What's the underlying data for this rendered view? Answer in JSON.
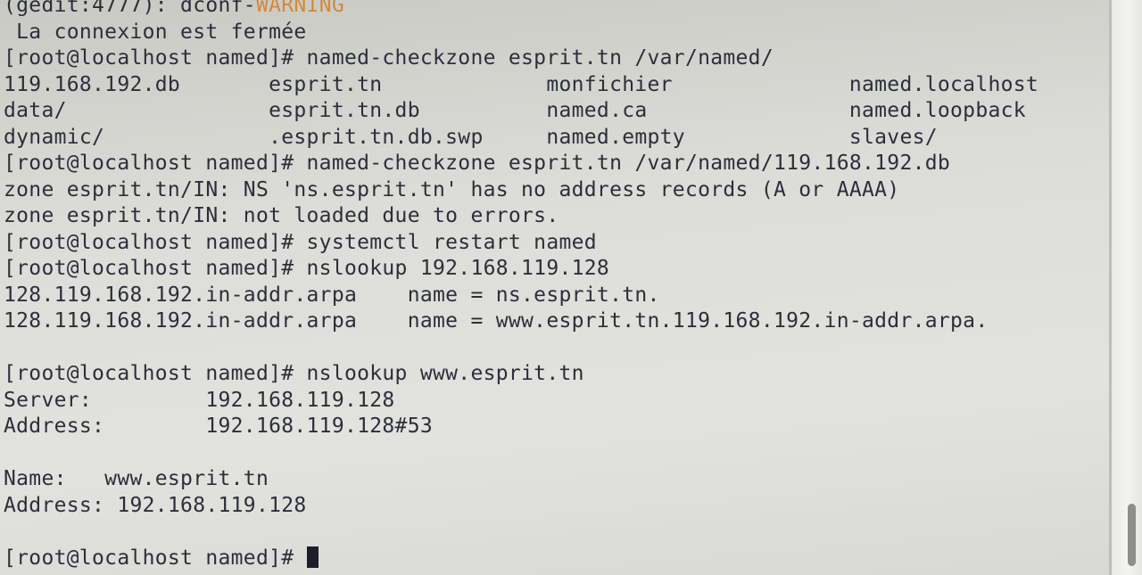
{
  "terminal": {
    "lines": {
      "l0_prefix": "(gedit:4777): dconf-",
      "l0_warning": "WARNING",
      "l1": " La connexion est fermée",
      "l2": "[root@localhost named]# named-checkzone esprit.tn /var/named/",
      "l3": "119.168.192.db       esprit.tn             monfichier              named.localhost",
      "l4": "data/                esprit.tn.db          named.ca                named.loopback",
      "l5": "dynamic/             .esprit.tn.db.swp     named.empty             slaves/",
      "l6": "[root@localhost named]# named-checkzone esprit.tn /var/named/119.168.192.db",
      "l7": "zone esprit.tn/IN: NS 'ns.esprit.tn' has no address records (A or AAAA)",
      "l8": "zone esprit.tn/IN: not loaded due to errors.",
      "l9": "[root@localhost named]# systemctl restart named",
      "l10": "[root@localhost named]# nslookup 192.168.119.128",
      "l11": "128.119.168.192.in-addr.arpa    name = ns.esprit.tn.",
      "l12": "128.119.168.192.in-addr.arpa    name = www.esprit.tn.119.168.192.in-addr.arpa.",
      "l13": "",
      "l14": "[root@localhost named]# nslookup www.esprit.tn",
      "l15": "Server:         192.168.119.128",
      "l16": "Address:        192.168.119.128#53",
      "l17": "",
      "l18": "Name:   www.esprit.tn",
      "l19": "Address: 192.168.119.128",
      "l20": "",
      "l21": "[root@localhost named]# "
    }
  }
}
